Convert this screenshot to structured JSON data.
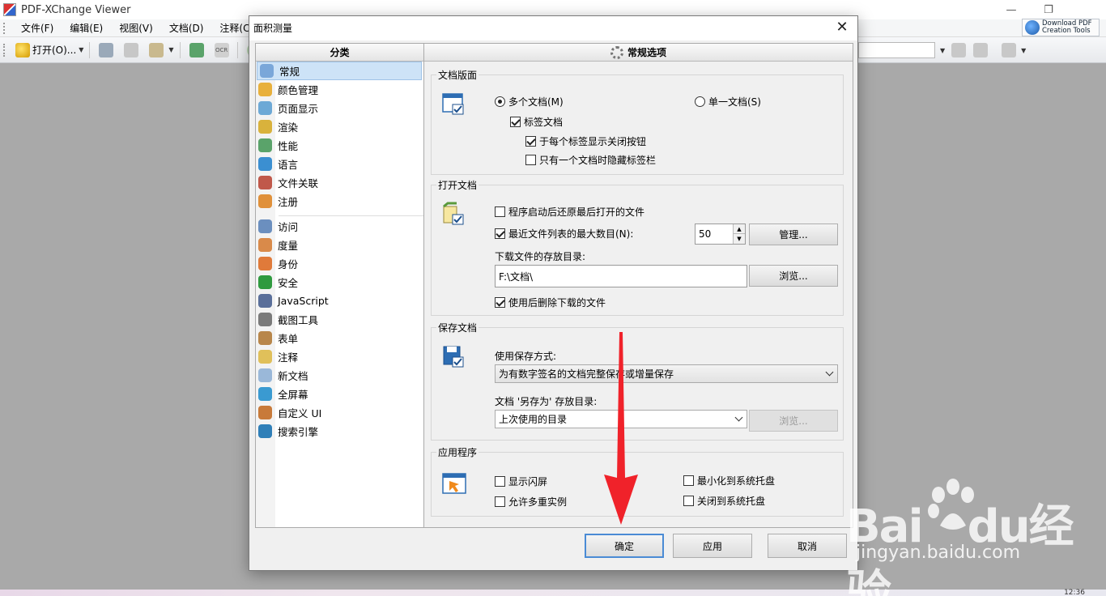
{
  "app": {
    "title": "PDF-XChange Viewer",
    "menu": [
      "文件(F)",
      "编辑(E)",
      "视图(V)",
      "文档(D)",
      "注释(C)"
    ],
    "toolbar": {
      "open_label": "打开(O)..."
    },
    "download_button": {
      "line1": "Download PDF",
      "line2": "Creation Tools"
    },
    "clock": "12:36"
  },
  "dialog": {
    "title": "面积测量",
    "close_symbol": "✕",
    "category_header": "分类",
    "options_header": "常规选项",
    "categories_top": [
      {
        "label": "常规",
        "icon": "general-icon",
        "selected": true
      },
      {
        "label": "颜色管理",
        "icon": "color-management-icon"
      },
      {
        "label": "页面显示",
        "icon": "page-display-icon"
      },
      {
        "label": "渲染",
        "icon": "render-icon"
      },
      {
        "label": "性能",
        "icon": "performance-icon"
      },
      {
        "label": "语言",
        "icon": "language-icon"
      },
      {
        "label": "文件关联",
        "icon": "file-association-icon"
      },
      {
        "label": "注册",
        "icon": "register-icon"
      }
    ],
    "categories_bottom": [
      {
        "label": "访问",
        "icon": "access-icon"
      },
      {
        "label": "度量",
        "icon": "measure-icon"
      },
      {
        "label": "身份",
        "icon": "identity-icon"
      },
      {
        "label": "安全",
        "icon": "security-icon"
      },
      {
        "label": "JavaScript",
        "icon": "javascript-icon"
      },
      {
        "label": "截图工具",
        "icon": "snapshot-icon"
      },
      {
        "label": "表单",
        "icon": "forms-icon"
      },
      {
        "label": "注释",
        "icon": "comments-icon"
      },
      {
        "label": "新文档",
        "icon": "new-document-icon"
      },
      {
        "label": "全屏幕",
        "icon": "fullscreen-icon"
      },
      {
        "label": "自定义 UI",
        "icon": "customize-ui-icon"
      },
      {
        "label": "搜索引擎",
        "icon": "search-engine-icon"
      }
    ],
    "groups": {
      "doc_layout": {
        "title": "文档版面",
        "multi_doc": "多个文档(M)",
        "single_doc": "单一文档(S)",
        "tabbed": "标签文档",
        "show_close_btn": "于每个标签显示关闭按钮",
        "hide_tabs": "只有一个文档时隐藏标签栏"
      },
      "open_doc": {
        "title": "打开文档",
        "restore_last": "程序启动后还原最后打开的文件",
        "max_recent": "最近文件列表的最大数目(N):",
        "max_recent_value": "50",
        "manage_button": "管理...",
        "download_dir_label": "下载文件的存放目录:",
        "download_dir_value": "F:\\文档\\",
        "browse_button": "浏览...",
        "delete_after_use": "使用后删除下载的文件"
      },
      "save_doc": {
        "title": "保存文档",
        "save_method_label": "使用保存方式:",
        "save_method_value": "为有数字签名的文档完整保存或增量保存",
        "save_as_label": "文档 '另存为' 存放目录:",
        "save_as_value": "上次使用的目录",
        "browse_button": "浏览..."
      },
      "application": {
        "title": "应用程序",
        "show_splash": "显示闪屏",
        "minimize_tray": "最小化到系统托盘",
        "multi_instance": "允许多重实例",
        "close_tray": "关闭到系统托盘"
      }
    },
    "buttons": {
      "ok": "确定",
      "apply": "应用",
      "cancel": "取消"
    }
  },
  "watermark": {
    "brand": "Bai",
    "brand2": "du",
    "cn": "经验",
    "url": "jingyan.baidu.com"
  },
  "colors": {
    "selection": "#cde3f7",
    "accent": "#4a8bd5",
    "arrow": "#f0222a"
  }
}
